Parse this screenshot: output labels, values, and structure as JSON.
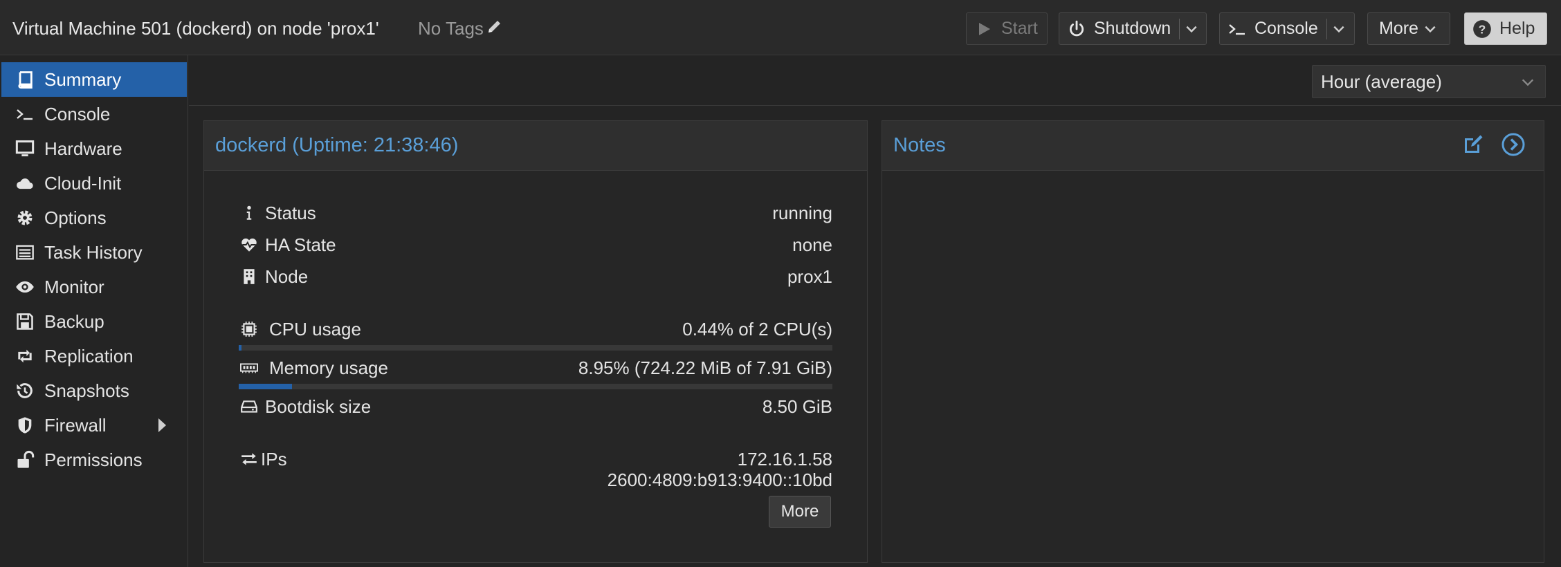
{
  "header": {
    "title": "Virtual Machine 501 (dockerd) on node 'prox1'",
    "tags_label": "No Tags",
    "buttons": {
      "start": "Start",
      "shutdown": "Shutdown",
      "console": "Console",
      "more": "More",
      "help": "Help"
    }
  },
  "sidebar": {
    "items": [
      {
        "label": "Summary",
        "icon": "book-icon"
      },
      {
        "label": "Console",
        "icon": "terminal-icon"
      },
      {
        "label": "Hardware",
        "icon": "monitor-icon"
      },
      {
        "label": "Cloud-Init",
        "icon": "cloud-icon"
      },
      {
        "label": "Options",
        "icon": "gear-icon"
      },
      {
        "label": "Task History",
        "icon": "list-icon"
      },
      {
        "label": "Monitor",
        "icon": "eye-icon"
      },
      {
        "label": "Backup",
        "icon": "floppy-icon"
      },
      {
        "label": "Replication",
        "icon": "retweet-icon"
      },
      {
        "label": "Snapshots",
        "icon": "history-icon"
      },
      {
        "label": "Firewall",
        "icon": "shield-icon"
      },
      {
        "label": "Permissions",
        "icon": "unlock-icon"
      }
    ],
    "active_index": 0
  },
  "timeframe": {
    "value": "Hour (average)"
  },
  "summary": {
    "title": "dockerd (Uptime: 21:38:46)",
    "status": {
      "label": "Status",
      "value": "running"
    },
    "ha_state": {
      "label": "HA State",
      "value": "none"
    },
    "node": {
      "label": "Node",
      "value": "prox1"
    },
    "cpu": {
      "label": "CPU usage",
      "value": "0.44% of 2 CPU(s)",
      "fraction": 0.0044
    },
    "memory": {
      "label": "Memory usage",
      "value": "8.95% (724.22 MiB of 7.91 GiB)",
      "fraction": 0.0895
    },
    "bootdisk": {
      "label": "Bootdisk size",
      "value": "8.50 GiB"
    },
    "ips": {
      "label": "IPs",
      "ipv4": "172.16.1.58",
      "ipv6": "2600:4809:b913:9400::10bd",
      "more_label": "More"
    }
  },
  "notes": {
    "title": "Notes"
  },
  "colors": {
    "accent": "#2461a8",
    "link": "#5a9fd8",
    "background": "#242424"
  }
}
